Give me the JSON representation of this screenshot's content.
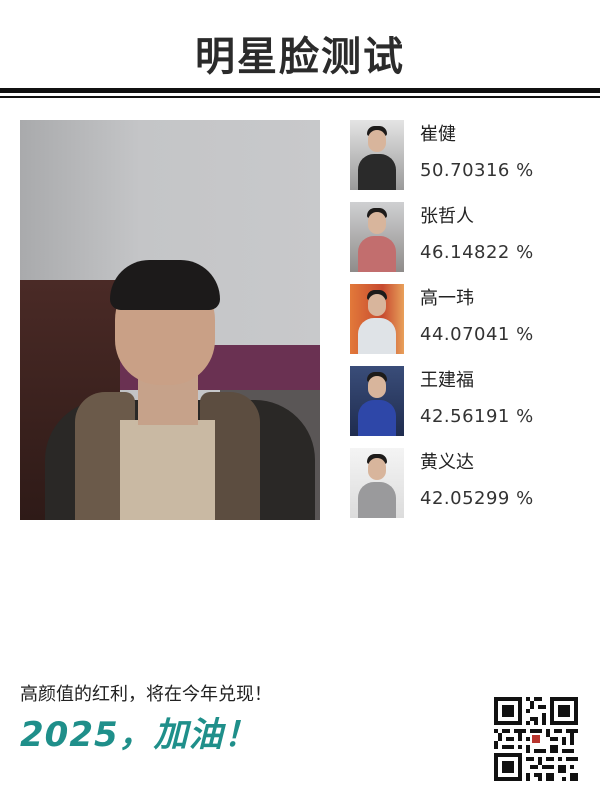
{
  "header": {
    "title": "明星脸测试"
  },
  "matches": [
    {
      "name": "崔健",
      "score": "50.70316 %"
    },
    {
      "name": "张哲人",
      "score": "46.14822 %"
    },
    {
      "name": "高一玮",
      "score": "44.07041 %"
    },
    {
      "name": "王建福",
      "score": "42.56191 %"
    },
    {
      "name": "黄义达",
      "score": "42.05299 %"
    }
  ],
  "footer": {
    "slogan": "高颜值的红利，将在今年兑现！",
    "cheer": "2025，加油！"
  },
  "colors": {
    "accent": "#1f8f8a",
    "rule": "#111111"
  }
}
